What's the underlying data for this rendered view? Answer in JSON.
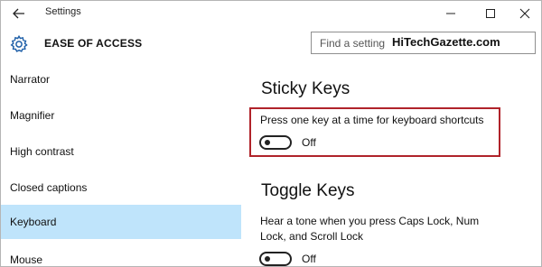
{
  "window": {
    "title": "Settings"
  },
  "header": {
    "title": "EASE OF ACCESS",
    "search_placeholder": "Find a setting",
    "watermark": "HiTechGazette.com"
  },
  "sidebar": {
    "items": [
      {
        "label": "Narrator",
        "selected": false
      },
      {
        "label": "Magnifier",
        "selected": false
      },
      {
        "label": "High contrast",
        "selected": false
      },
      {
        "label": "Closed captions",
        "selected": false
      },
      {
        "label": "Keyboard",
        "selected": true
      },
      {
        "label": "Mouse",
        "selected": false
      }
    ]
  },
  "content": {
    "sticky_keys": {
      "heading": "Sticky Keys",
      "description": "Press one key at a time for keyboard shortcuts",
      "toggle_state": "Off"
    },
    "toggle_keys": {
      "heading": "Toggle Keys",
      "description": "Hear a tone when you press Caps Lock, Num Lock, and Scroll Lock",
      "toggle_state": "Off"
    }
  },
  "colors": {
    "selected_nav": "#bfe4fb",
    "highlight_border": "#b0232a"
  }
}
